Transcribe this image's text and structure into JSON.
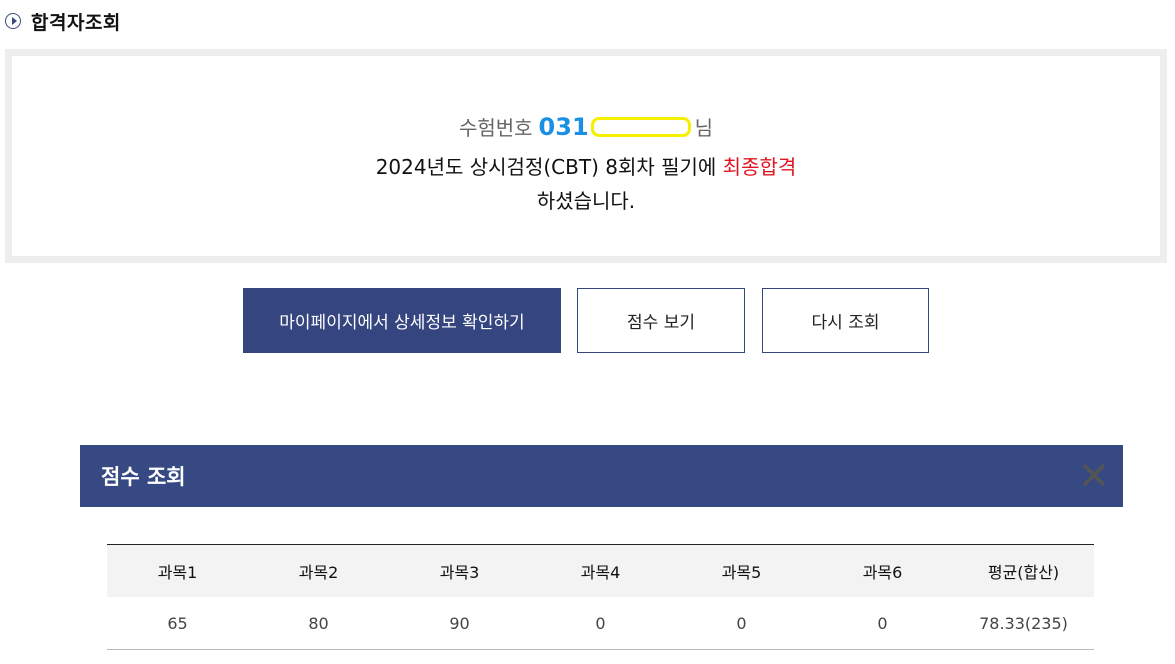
{
  "header": {
    "title": "합격자조회"
  },
  "result": {
    "label": "수험번호",
    "number": "031",
    "suffix": "님",
    "exam_text": "2024년도 상시검정(CBT) 8회차 필기에 ",
    "pass_text": "최종합격",
    "line3": "하셨습니다."
  },
  "buttons": {
    "mypage": "마이페이지에서 상세정보 확인하기",
    "score": "점수 보기",
    "retry": "다시 조회"
  },
  "score_panel": {
    "title": "점수 조회",
    "headers": [
      "과목1",
      "과목2",
      "과목3",
      "과목4",
      "과목5",
      "과목6",
      "평균(합산)"
    ],
    "values": [
      "65",
      "80",
      "90",
      "0",
      "0",
      "0",
      "78.33(235)"
    ]
  },
  "colors": {
    "primary": "#344580",
    "accent_blue": "#1a8fe3",
    "pass_red": "#e0141e",
    "mask_yellow": "#f5f000"
  },
  "icons": {
    "header": "play-circle-icon",
    "close": "close-icon"
  }
}
